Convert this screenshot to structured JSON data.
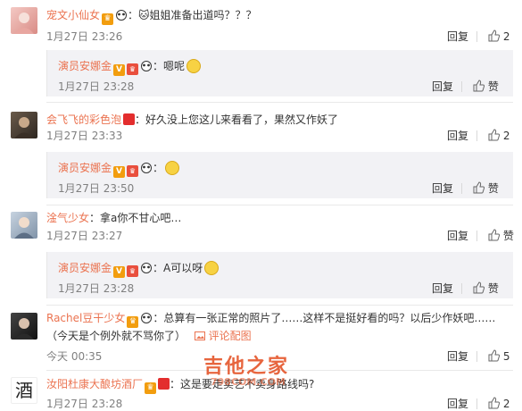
{
  "colors": {
    "name": "#eb7350",
    "meta": "#808080",
    "reply_bg": "#f2f2f5"
  },
  "actions": {
    "reply": "回复"
  },
  "comments": [
    {
      "name": "宠文小仙女",
      "text": "：🐱姐姐准备出道吗？？？",
      "time": "1月27日 23:26",
      "likes": "2",
      "reply": {
        "name": "演员安娜金",
        "text": "：嗯呢",
        "time": "1月27日 23:28",
        "likes": "赞"
      }
    },
    {
      "name": "会飞飞的彩色泡",
      "text": "：好久没上您这儿来看看了，果然又作妖了",
      "time": "1月27日 23:33",
      "likes": "2",
      "reply": {
        "name": "演员安娜金",
        "text": "：",
        "time": "1月27日 23:50",
        "likes": "赞"
      }
    },
    {
      "name": "淦气少女",
      "text": "：拿a你不甘心吧…",
      "time": "1月27日 23:27",
      "likes": "赞",
      "reply": {
        "name": "演员安娜金",
        "text": "：A可以呀",
        "time": "1月27日 23:28",
        "likes": "赞"
      }
    },
    {
      "name": "Rachel豆干少女",
      "text": "：总算有一张正常的照片了……这样不是挺好看的吗？以后少作妖吧……",
      "text2": "（今天是个例外就不骂你了）",
      "pic_link": "评论配图",
      "time": "今天 00:35",
      "likes": "5"
    },
    {
      "name": "汝阳杜康大酿坊酒厂",
      "text": "：这是要走卖艺不卖身路线吗?",
      "time": "1月27日 23:28",
      "likes": "2"
    }
  ],
  "watermark": {
    "line1": "吉他之家",
    "line2": "798COM.COM"
  }
}
